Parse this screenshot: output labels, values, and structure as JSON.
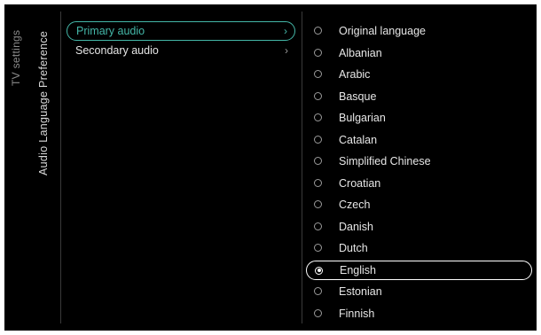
{
  "breadcrumb": "TV settings",
  "section_title": "Audio Language Preference",
  "menu": {
    "items": [
      {
        "label": "Primary audio",
        "chevron": "›",
        "selected": true
      },
      {
        "label": "Secondary audio",
        "chevron": "›",
        "selected": false
      }
    ]
  },
  "languages": {
    "options": [
      "Original language",
      "Albanian",
      "Arabic",
      "Basque",
      "Bulgarian",
      "Catalan",
      "Simplified Chinese",
      "Croatian",
      "Czech",
      "Danish",
      "Dutch",
      "English",
      "Estonian",
      "Finnish"
    ],
    "selected": "English"
  },
  "colors": {
    "background": "#000000",
    "accent": "#44b7a8",
    "text": "#e6e6e6"
  }
}
